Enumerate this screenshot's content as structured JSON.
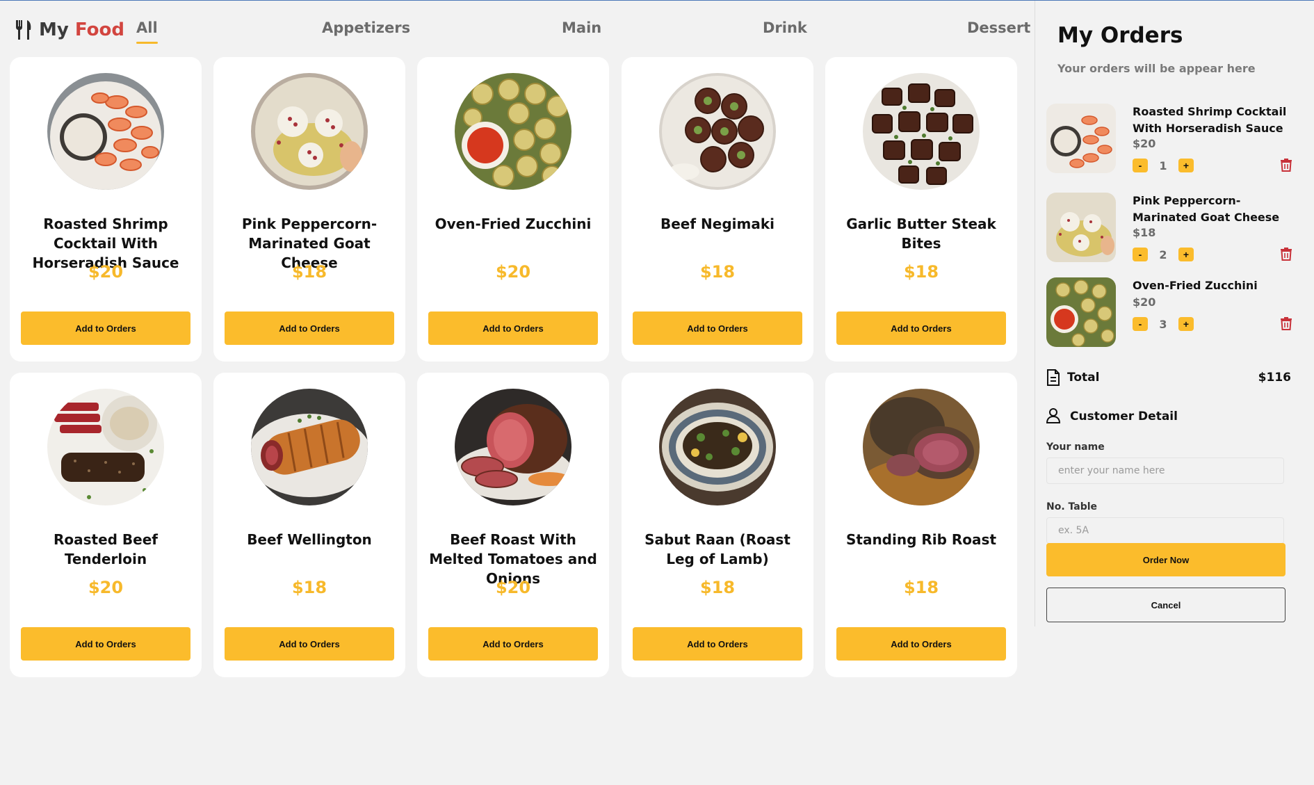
{
  "brand": {
    "my": "My",
    "food": "Food"
  },
  "nav": {
    "tabs": [
      {
        "label": "All",
        "active": true
      },
      {
        "label": "Appetizers",
        "active": false
      },
      {
        "label": "Main",
        "active": false
      },
      {
        "label": "Drink",
        "active": false
      },
      {
        "label": "Dessert",
        "active": false
      }
    ]
  },
  "menu": {
    "add_label": "Add to Orders",
    "items": [
      {
        "name": "Roasted Shrimp Cocktail With Horseradish Sauce",
        "price": "$20"
      },
      {
        "name": "Pink Peppercorn-Marinated Goat Cheese",
        "price": "$18"
      },
      {
        "name": "Oven-Fried Zucchini",
        "price": "$20"
      },
      {
        "name": "Beef Negimaki",
        "price": "$18"
      },
      {
        "name": "Garlic Butter Steak Bites",
        "price": "$18"
      },
      {
        "name": "Roasted Beef Tenderloin",
        "price": "$20"
      },
      {
        "name": "Beef Wellington",
        "price": "$18"
      },
      {
        "name": "Beef Roast With Melted Tomatoes and Onions",
        "price": "$20"
      },
      {
        "name": "Sabut Raan (Roast Leg of Lamb)",
        "price": "$18"
      },
      {
        "name": "Standing Rib Roast",
        "price": "$18"
      }
    ]
  },
  "orders": {
    "title": "My Orders",
    "subtitle": "Your orders will be appear here",
    "items": [
      {
        "name": "Roasted Shrimp Cocktail With Horseradish Sauce",
        "price": "$20",
        "qty": "1"
      },
      {
        "name": "Pink Peppercorn-Marinated Goat Cheese",
        "price": "$18",
        "qty": "2"
      },
      {
        "name": "Oven-Fried Zucchini",
        "price": "$20",
        "qty": "3"
      }
    ],
    "minus": "-",
    "plus": "+",
    "total_label": "Total",
    "total_value": "$116",
    "customer_label": "Customer Detail",
    "name_label": "Your name",
    "name_placeholder": "enter your name here",
    "table_label": "No. Table",
    "table_placeholder": "ex. 5A",
    "order_now": "Order Now",
    "cancel": "Cancel"
  },
  "colors": {
    "accent": "#fbbc2c",
    "price": "#f7b92b",
    "brand_food": "#d2453f",
    "trash": "#c8323a"
  },
  "icons": {
    "brand": "fork-knife-icon",
    "trash": "trash-icon",
    "total": "receipt-icon",
    "customer": "user-icon"
  }
}
